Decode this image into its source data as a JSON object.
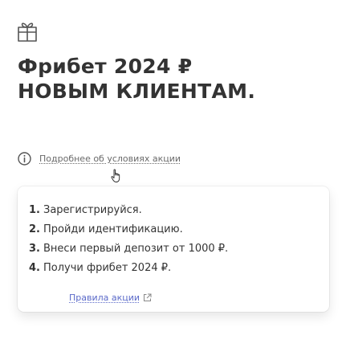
{
  "headline": {
    "line1": "Фрибет 2024 ₽",
    "line2": "НОВЫМ КЛИЕНТАМ."
  },
  "promo": {
    "details_link": "Подробнее об условиях акции"
  },
  "steps": [
    {
      "num": "1.",
      "text": "Зарегистрируйся."
    },
    {
      "num": "2.",
      "text": "Пройди идентификацию."
    },
    {
      "num": "3.",
      "text": "Внеси первый депозит от 1000 ₽."
    },
    {
      "num": "4.",
      "text": "Получи фрибет 2024 ₽."
    }
  ],
  "rules": {
    "link": "Правила акции"
  },
  "icons": {
    "gift": "gift-icon",
    "info": "info-icon",
    "cursor": "hand-pointer-icon",
    "external": "external-link-icon"
  },
  "colors": {
    "text": "#333333",
    "muted": "#6a6a6a",
    "link": "#5b6ac9"
  }
}
